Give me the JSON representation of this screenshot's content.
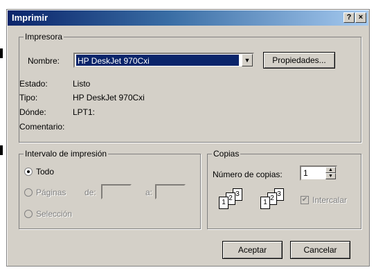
{
  "window": {
    "title": "Imprimir",
    "help_label": "?",
    "close_label": "×"
  },
  "printer": {
    "legend": "Impresora",
    "name_label": "Nombre:",
    "name_value": "HP DeskJet 970Cxi",
    "properties_button": "Propiedades...",
    "status_label": "Estado:",
    "status_value": "Listo",
    "type_label": "Tipo:",
    "type_value": "HP DeskJet 970Cxi",
    "where_label": "Dónde:",
    "where_value": "LPT1:",
    "comment_label": "Comentario:"
  },
  "range": {
    "legend": "Intervalo de impresión",
    "all_label": "Todo",
    "pages_label": "Páginas",
    "from_label": "de:",
    "to_label": "a:",
    "selection_label": "Selección",
    "selected": "Todo"
  },
  "copies": {
    "legend": "Copias",
    "count_label": "Número de copias:",
    "count_value": "1",
    "collate_label": "Intercalar",
    "collate_checked": true,
    "page_numbers": [
      "1",
      "2",
      "3"
    ],
    "spin_up": "▲",
    "spin_down": "▼"
  },
  "actions": {
    "ok_label": "Aceptar",
    "cancel_label": "Cancelar"
  },
  "icons": {
    "combo_arrow": "▼",
    "radio_selected": "Todo",
    "checkbox_mark": "✔"
  }
}
